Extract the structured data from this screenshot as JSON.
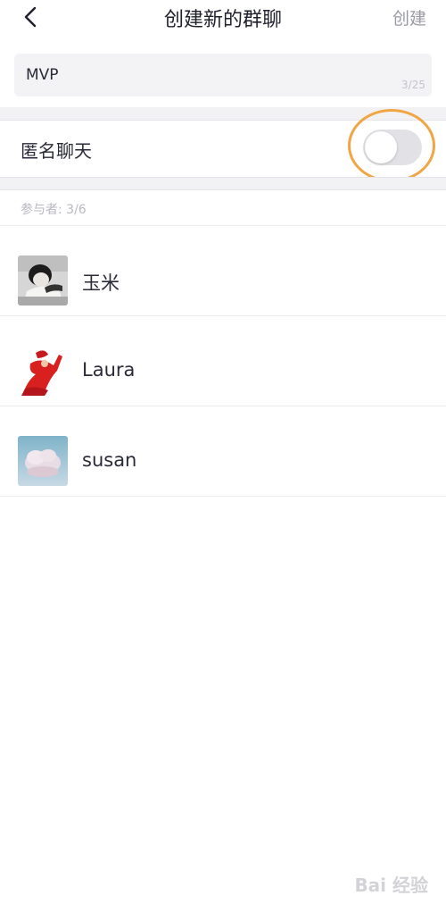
{
  "header": {
    "title": "创建新的群聊",
    "create_label": "创建"
  },
  "name_field": {
    "value": "MVP",
    "char_count": "3/25"
  },
  "anonymous": {
    "label": "匿名聊天",
    "enabled": false
  },
  "participants": {
    "header": "参与者: 3/6",
    "members": [
      {
        "name": "玉米",
        "avatar": "bw-portrait-avatar"
      },
      {
        "name": "Laura",
        "avatar": "red-dress-avatar"
      },
      {
        "name": "susan",
        "avatar": "cloud-sky-avatar"
      }
    ]
  },
  "icons": {
    "back": "chevron-left-icon"
  },
  "colors": {
    "highlight_ring": "#f0a645",
    "toggle_off": "#e2e2e6",
    "section_gap": "#f2f2f5"
  },
  "watermark": "Bai 经验"
}
